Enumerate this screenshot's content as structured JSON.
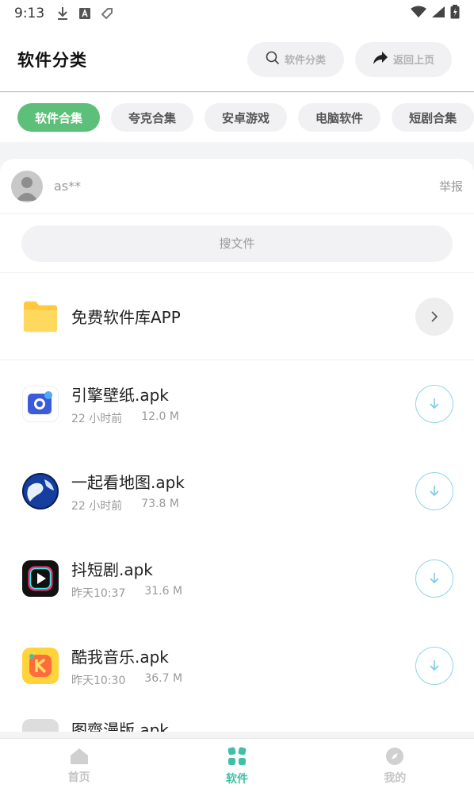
{
  "status_bar": {
    "time": "9:13"
  },
  "header": {
    "title": "软件分类",
    "search_label": "软件分类",
    "back_label": "返回上页"
  },
  "tabs": [
    {
      "label": "软件合集",
      "active": true
    },
    {
      "label": "夸克合集",
      "active": false
    },
    {
      "label": "安卓游戏",
      "active": false
    },
    {
      "label": "电脑软件",
      "active": false
    },
    {
      "label": "短剧合集",
      "active": false
    }
  ],
  "user": {
    "name": "as**",
    "report_label": "举报"
  },
  "search": {
    "placeholder": "搜文件"
  },
  "folder": {
    "name": "免费软件库APP"
  },
  "files": [
    {
      "name": "引擎壁纸.apk",
      "time": "22 小时前",
      "size": "12.0 M"
    },
    {
      "name": "一起看地图.apk",
      "time": "22 小时前",
      "size": "73.8 M"
    },
    {
      "name": "抖短剧.apk",
      "time": "昨天10:37",
      "size": "31.6 M"
    },
    {
      "name": "酷我音乐.apk",
      "time": "昨天10:30",
      "size": "36.7 M"
    }
  ],
  "partial_file": {
    "name": "图齊漫版.apk"
  },
  "nav": [
    {
      "label": "首页"
    },
    {
      "label": "软件"
    },
    {
      "label": "我的"
    }
  ],
  "colors": {
    "accent_green": "#5dc07a",
    "nav_active": "#3fc0a6",
    "download_ring": "#8fd3ef",
    "folder_yellow": "#ffd24a"
  }
}
